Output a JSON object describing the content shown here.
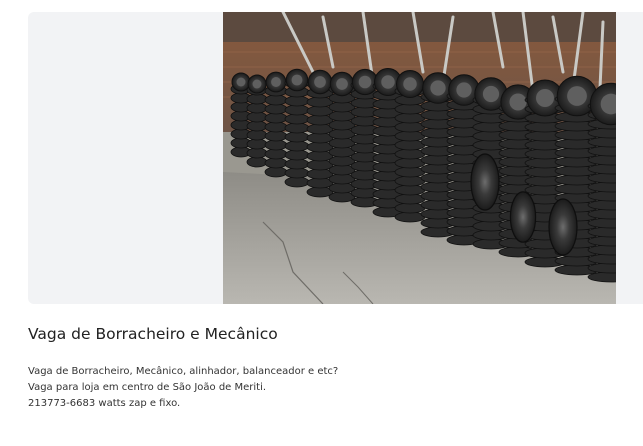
{
  "listing": {
    "image_alt": "tire-shop-photo",
    "title": "Vaga de Borracheiro e Mecânico",
    "description_lines": [
      "Vaga de Borracheiro, Mecânico, alinhador, balanceador e etc?",
      "Vaga para loja em centro de São João de Meriti.",
      "213773-6683 watts zap e fixo."
    ]
  }
}
